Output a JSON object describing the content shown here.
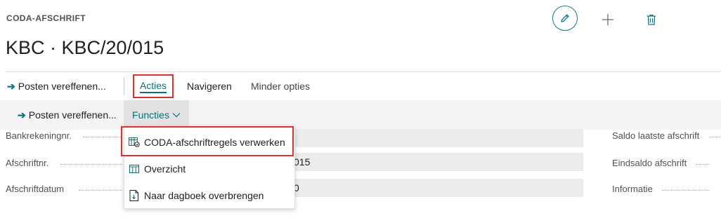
{
  "header": {
    "caption": "CODA-AFSCHRIFT",
    "title": "KBC · KBC/20/015",
    "edit_icon": "pencil-icon",
    "new_icon": "plus-icon",
    "delete_icon": "trash-icon"
  },
  "actionbar": {
    "post_apply": "Posten vereffenen...",
    "acties": "Acties",
    "navigeren": "Navigeren",
    "minder_opties": "Minder opties"
  },
  "subbar": {
    "post_apply": "Posten vereffenen...",
    "functies": "Functies"
  },
  "menu": {
    "items": [
      {
        "label": "CODA-afschriftregels verwerken",
        "icon": "process-lines-icon"
      },
      {
        "label": "Overzicht",
        "icon": "table-icon"
      },
      {
        "label": "Naar dagboek overbrengen",
        "icon": "document-transfer-icon"
      }
    ]
  },
  "fields": {
    "left": [
      {
        "label": "Bankrekeningnr.",
        "value": ""
      },
      {
        "label": "Afschriftnr.",
        "value": "015"
      },
      {
        "label": "Afschriftdatum",
        "value": "0"
      }
    ],
    "right": [
      {
        "label": "Saldo laatste afschrift"
      },
      {
        "label": "Eindsaldo afschrift"
      },
      {
        "label": "Informatie"
      }
    ]
  },
  "colors": {
    "accent": "#0a6f7a",
    "highlight": "#d8342c"
  }
}
